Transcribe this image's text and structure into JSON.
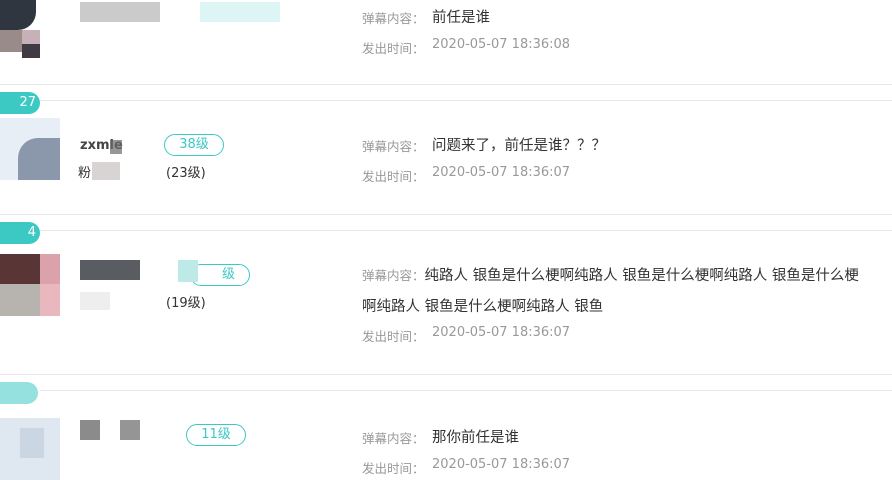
{
  "labels": {
    "content": "弹幕内容：",
    "time": "发出时间："
  },
  "colors": {
    "accent": "#3cc9c4",
    "separator": "#e6e6e6",
    "label": "#999999",
    "text": "#333333"
  },
  "comments": [
    {
      "content": "前任是谁",
      "time": "2020-05-07 18:36:08"
    },
    {
      "rank": "27",
      "name_partial": "zxmle",
      "level": "38级",
      "fans_prefix": "粉",
      "fans_level": "(23级)",
      "content": "问题来了，前任是谁？？？",
      "time": "2020-05-07 18:36:07"
    },
    {
      "rank": "4",
      "level": "级",
      "fans_level": "(19级)",
      "content": "纯路人 银鱼是什么梗啊纯路人 银鱼是什么梗啊纯路人 银鱼是什么梗啊纯路人 银鱼是什么梗啊纯路人 银鱼",
      "time": "2020-05-07 18:36:07"
    },
    {
      "level": "11级",
      "content": "那你前任是谁",
      "time": "2020-05-07 18:36:07"
    }
  ]
}
